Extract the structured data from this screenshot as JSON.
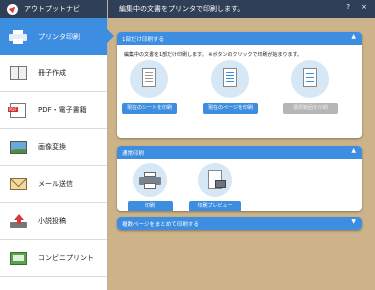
{
  "app": {
    "title": "アウトプットナビ"
  },
  "header": {
    "title": "編集中の文書をプリンタで印刷します。",
    "help": "?",
    "close": "×"
  },
  "sidebar": {
    "items": [
      {
        "label": "プリンタ印刷",
        "icon": "printer-icon",
        "active": true
      },
      {
        "label": "冊子作成",
        "icon": "book-icon"
      },
      {
        "label": "PDF・電子書籍",
        "icon": "pdf-icon"
      },
      {
        "label": "画像変換",
        "icon": "image-icon"
      },
      {
        "label": "メール送信",
        "icon": "mail-icon"
      },
      {
        "label": "小説投稿",
        "icon": "upload-icon"
      },
      {
        "label": "コンビニプリント",
        "icon": "convenience-print-icon"
      }
    ]
  },
  "panels": {
    "single": {
      "title": "1部だけ印刷する",
      "chevron": "▲",
      "description": "編集中の文書を1部だけ印刷します。 ※ボタンのクリックで印刷が始まります。",
      "buttons": [
        {
          "label": "現在のシートを印刷",
          "enabled": true
        },
        {
          "label": "現在のページを印刷",
          "enabled": true
        },
        {
          "label": "選択範囲を印刷",
          "enabled": false
        }
      ]
    },
    "normal": {
      "title": "通常印刷",
      "chevron": "▲",
      "buttons": [
        {
          "label": "印刷"
        },
        {
          "label": "印刷プレビュー"
        }
      ]
    },
    "multi": {
      "title": "複数ページをまとめて印刷する",
      "chevron": "▼"
    }
  },
  "colors": {
    "accent": "#3d8ee0",
    "header_bg": "#2f3f57",
    "background": "#cdb389",
    "disabled": "#b6b6b6"
  }
}
